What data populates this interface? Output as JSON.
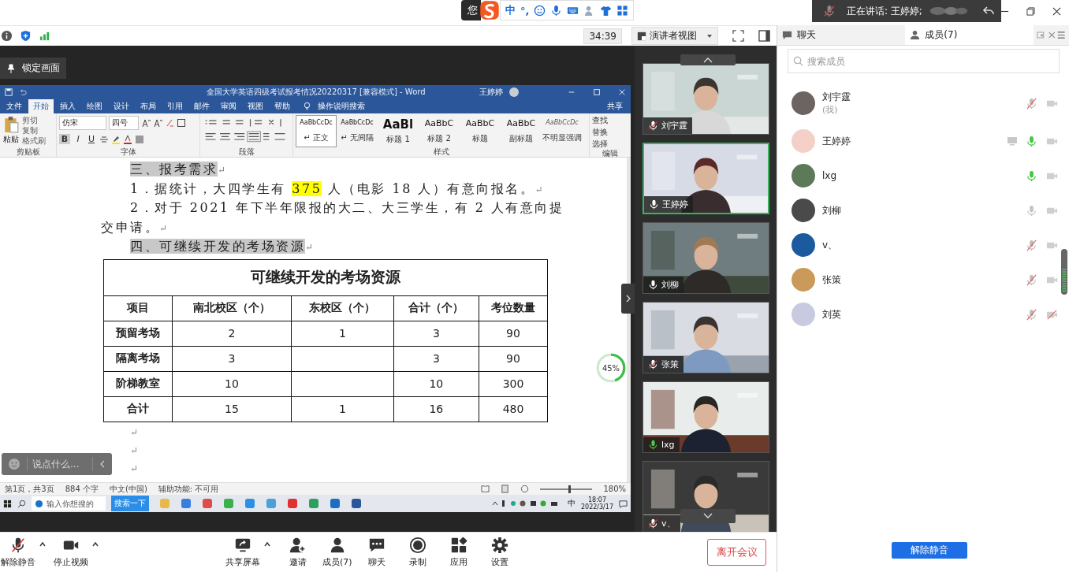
{
  "top_bar": {
    "ime": {
      "text": "您",
      "lang": "中",
      "punct": "°,"
    },
    "speaking": {
      "label": "正在讲话: 王婷婷;"
    }
  },
  "toolbar": {
    "timer": "34:39",
    "view": "演讲者视图"
  },
  "side_tabs": [
    {
      "label": "聊天",
      "selected": false
    },
    {
      "label": "成员(7)",
      "selected": true
    }
  ],
  "share": {
    "lock_label": "锁定画面",
    "word": {
      "title": "全国大学英语四级考试报考情况20220317 [兼容模式] - Word",
      "user": "王婷婷",
      "tabs": [
        {
          "label": "文件",
          "selected": false
        },
        {
          "label": "开始",
          "selected": true
        },
        {
          "label": "插入",
          "selected": false
        },
        {
          "label": "绘图",
          "selected": false
        },
        {
          "label": "设计",
          "selected": false
        },
        {
          "label": "布局",
          "selected": false
        },
        {
          "label": "引用",
          "selected": false
        },
        {
          "label": "邮件",
          "selected": false
        },
        {
          "label": "审阅",
          "selected": false
        },
        {
          "label": "视图",
          "selected": false
        },
        {
          "label": "帮助",
          "selected": false
        }
      ],
      "tell_me": "操作说明搜索",
      "share_label": "共享",
      "clipboard": {
        "label": "剪贴板",
        "paste": "粘贴",
        "items": [
          "剪切",
          "复制",
          "格式刷"
        ]
      },
      "font": {
        "label": "字体",
        "name": "仿宋",
        "size": "四号",
        "format": [
          "B",
          "I",
          "U"
        ]
      },
      "paragraph": {
        "label": "段落"
      },
      "styles": {
        "label": "样式",
        "items": [
          {
            "preview": "AaBbCcDc",
            "name": "↵ 正文",
            "selected": true,
            "kind": "normal"
          },
          {
            "preview": "AaBbCcDc",
            "name": "↵ 无间隔",
            "selected": false,
            "kind": "normal"
          },
          {
            "preview": "AaBl",
            "name": "标题 1",
            "selected": false,
            "kind": "big"
          },
          {
            "preview": "AaBbC",
            "name": "标题 2",
            "selected": false,
            "kind": "medium"
          },
          {
            "preview": "AaBbC",
            "name": "标题",
            "selected": false,
            "kind": "medium"
          },
          {
            "preview": "AaBbC",
            "name": "副标题",
            "selected": false,
            "kind": "medium"
          },
          {
            "preview": "AaBbCcDc",
            "name": "不明显强调",
            "selected": false,
            "kind": "italic"
          }
        ]
      },
      "editing": {
        "label": "编辑",
        "items": [
          "查找",
          "替换",
          "选择"
        ]
      },
      "lines": [
        {
          "kind": "heading",
          "runs": [
            {
              "text": "三、报考需求",
              "highlight": true
            }
          ],
          "end": "↵"
        },
        {
          "kind": "body",
          "runs": [
            {
              "text": "1．据统计，大四学生有 ",
              "highlight": false
            },
            {
              "text": "375",
              "highlight": true
            },
            {
              "text": " 人（电影 18 人）有意向报名。",
              "highlight": false
            }
          ],
          "end": "↵"
        },
        {
          "kind": "body",
          "runs": [
            {
              "text": "2．对于 2021 年下半年限报的大二、大三学生，有 2 人有意向提",
              "highlight": false
            }
          ]
        },
        {
          "kind": "continuation",
          "runs": [
            {
              "text": "交申请。",
              "highlight": false
            }
          ],
          "end": "↵"
        },
        {
          "kind": "heading",
          "runs": [
            {
              "text": "四、可继续开发的考场资源",
              "highlight": true
            }
          ],
          "end": "↵"
        }
      ],
      "table": {
        "title": "可继续开发的考场资源",
        "columns": [
          "项目",
          "南北校区（个）",
          "东校区（个）",
          "合计（个）",
          "考位数量"
        ],
        "rows": [
          [
            "预留考场",
            "2",
            "1",
            "3",
            "90"
          ],
          [
            "隔离考场",
            "3",
            null,
            "3",
            "90"
          ],
          [
            "阶梯教室",
            "10",
            null,
            "10",
            "300"
          ],
          [
            "合计",
            "15",
            "1",
            "16",
            "480"
          ]
        ]
      },
      "after_table": [
        "↵",
        "↵",
        "↵"
      ],
      "status": {
        "items": [
          "第1页，共3页",
          "884 个字",
          "中文(中国)",
          "辅助功能: 不可用"
        ],
        "zoom": "180%",
        "level": 0.56
      },
      "taskbar": {
        "search_placeholder": "输入你想搜的",
        "search_button": "搜索一下",
        "lang": "中",
        "time": "18:07",
        "date": "2022/3/17"
      }
    },
    "meter": {
      "text": "45%",
      "level": 0.45
    },
    "chat_input": {
      "placeholder": "说点什么..."
    }
  },
  "videos": [
    {
      "name": "刘宇霆",
      "muted": true,
      "speaking": false,
      "active": false
    },
    {
      "name": "王婷婷",
      "muted": false,
      "speaking": false,
      "active": true
    },
    {
      "name": "刘柳",
      "muted": false,
      "speaking": false,
      "active": false
    },
    {
      "name": "张策",
      "muted": true,
      "speaking": false,
      "active": false
    },
    {
      "name": "lxg",
      "muted": false,
      "speaking": true,
      "active": false
    },
    {
      "name": "v、",
      "muted": true,
      "speaking": false,
      "active": false
    }
  ],
  "members_panel": {
    "search_placeholder": "搜索成员",
    "members": [
      {
        "name": "刘宇霆",
        "note": "(我)",
        "sharing": false,
        "muted": true,
        "speaking": false,
        "video_blocked": false
      },
      {
        "name": "王婷婷",
        "sharing": true,
        "muted": false,
        "speaking": true,
        "video_blocked": false
      },
      {
        "name": "lxg",
        "sharing": false,
        "muted": false,
        "speaking": true,
        "video_blocked": false
      },
      {
        "name": "刘柳",
        "sharing": false,
        "muted": false,
        "speaking": false,
        "video_blocked": false
      },
      {
        "name": "v、",
        "sharing": false,
        "muted": true,
        "speaking": false,
        "video_blocked": false
      },
      {
        "name": "张策",
        "sharing": false,
        "muted": true,
        "speaking": false,
        "video_blocked": false
      },
      {
        "name": "刘英",
        "sharing": false,
        "muted": true,
        "speaking": false,
        "video_blocked": true
      }
    ],
    "unmute_all": "解除静音"
  },
  "bottom_bar": {
    "items": [
      {
        "label": "解除静音",
        "caret": true
      },
      {
        "label": "停止视频",
        "caret": true
      },
      {
        "label": "共享屏幕",
        "caret": true
      },
      {
        "label": "邀请",
        "caret": false
      },
      {
        "label": "成员(7)",
        "caret": false
      },
      {
        "label": "聊天",
        "caret": false
      },
      {
        "label": "录制",
        "caret": false
      },
      {
        "label": "应用",
        "caret": false
      },
      {
        "label": "设置",
        "caret": false
      }
    ],
    "leave": "离开会议"
  }
}
